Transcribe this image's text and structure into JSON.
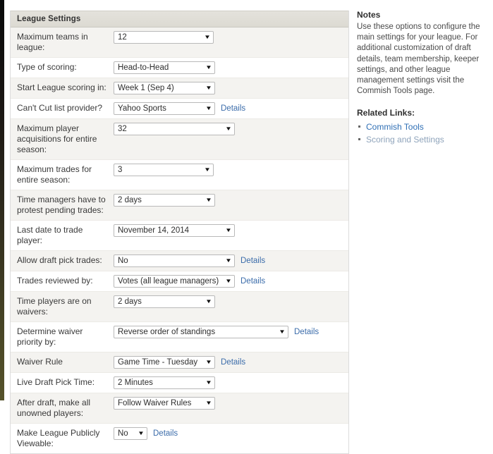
{
  "panel": {
    "title": "League Settings",
    "rows": [
      {
        "label": "Maximum teams in league:",
        "value": "12",
        "size": "w-sm",
        "details": null,
        "shade": "alt"
      },
      {
        "label": "Type of scoring:",
        "value": "Head-to-Head",
        "size": "w-md",
        "details": null,
        "shade": "plain"
      },
      {
        "label": "Start League scoring in:",
        "value": "Week 1 (Sep 4)",
        "size": "w-md",
        "details": null,
        "shade": "alt"
      },
      {
        "label": "Can't Cut list provider?",
        "value": "Yahoo Sports",
        "size": "w-md",
        "details": "Details",
        "shade": "plain"
      },
      {
        "label": "Maximum player acquisitions for entire season:",
        "value": "32",
        "size": "w-lg",
        "details": null,
        "shade": "alt"
      },
      {
        "label": "Maximum trades for entire season:",
        "value": "3",
        "size": "w-sm",
        "details": null,
        "shade": "plain"
      },
      {
        "label": "Time managers have to protest pending trades:",
        "value": "2 days",
        "size": "w-md",
        "details": null,
        "shade": "alt"
      },
      {
        "label": "Last date to trade player:",
        "value": "November 14, 2014",
        "size": "w-lg",
        "details": null,
        "shade": "plain"
      },
      {
        "label": "Allow draft pick trades:",
        "value": "No",
        "size": "w-lg",
        "details": "Details",
        "shade": "alt"
      },
      {
        "label": "Trades reviewed by:",
        "value": "Votes (all league managers)",
        "size": "w-lg",
        "details": "Details",
        "shade": "plain"
      },
      {
        "label": "Time players are on waivers:",
        "value": "2 days",
        "size": "w-md",
        "details": null,
        "shade": "alt"
      },
      {
        "label": "Determine waiver priority by:",
        "value": "Reverse order of standings",
        "size": "w-xl",
        "details": "Details",
        "shade": "plain"
      },
      {
        "label": "Waiver Rule",
        "value": "Game Time - Tuesday",
        "size": "w-md",
        "details": "Details",
        "shade": "alt"
      },
      {
        "label": "Live Draft Pick Time:",
        "value": "2 Minutes",
        "size": "w-md",
        "details": null,
        "shade": "plain"
      },
      {
        "label": "After draft, make all unowned players:",
        "value": "Follow Waiver Rules",
        "size": "w-md",
        "details": null,
        "shade": "alt"
      },
      {
        "label": "Make League Publicly Viewable:",
        "value": "No",
        "size": "w-xs",
        "details": "Details",
        "shade": "plain"
      }
    ]
  },
  "notes": {
    "title": "Notes",
    "body": "Use these options to configure the main settings for your league. For additional customization of draft details, team membership, keeper settings, and other league management settings visit the Commish Tools page.",
    "related_title": "Related Links:",
    "links": [
      {
        "label": "Commish Tools",
        "muted": false
      },
      {
        "label": "Scoring and Settings",
        "muted": true
      }
    ]
  },
  "colors": {
    "header_bg": "#dedcd5",
    "row_alt_bg": "#f4f3f0",
    "row_plain_bg": "#ffffff",
    "link": "#3b6caa",
    "link_muted": "#8fa4bb",
    "border": "#dcdcdc"
  },
  "icons": {
    "caret": "▼",
    "bullet": "•"
  }
}
